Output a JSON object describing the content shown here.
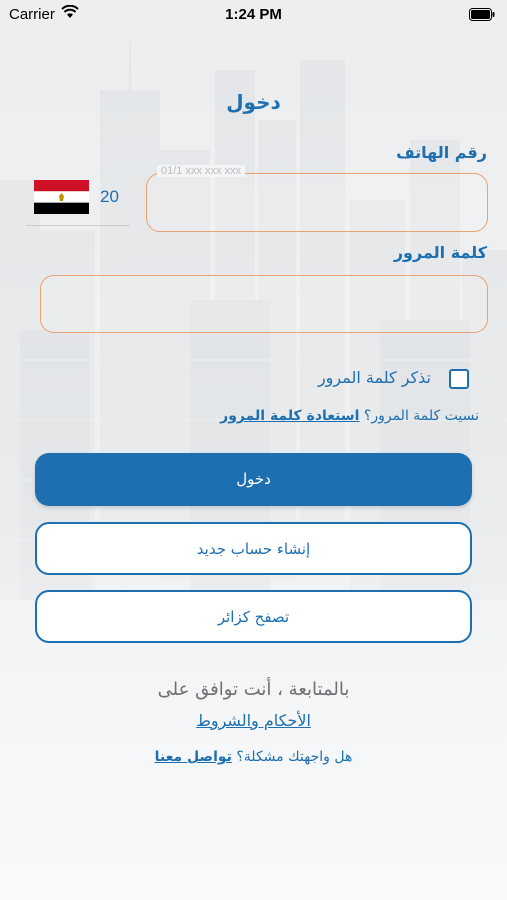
{
  "status_bar": {
    "carrier": "Carrier",
    "time": "1:24 PM"
  },
  "login": {
    "title": "دخول",
    "phone_label": "رقم الهاتف",
    "phone_placeholder": "01/1 xxx xxx xxx",
    "country_code": "20",
    "country_flag": "egypt-flag-icon",
    "password_label": "كلمة المرور",
    "remember_label": "تذكر كلمة المرور",
    "forgot_prefix": "نسيت كلمة المرور؟",
    "forgot_link": "استعادة كلمة المرور",
    "login_button": "دخول",
    "register_button": "إنشاء حساب جديد",
    "guest_button": "تصفح كزائر",
    "agree_text": "بالمتابعة ، أنت توافق على",
    "terms_link": "الأحكام والشروط",
    "contact_prefix": "هل واجهتك مشكلة؟",
    "contact_link": "تواصل معنا"
  },
  "colors": {
    "primary": "#1d6fb0",
    "field_border": "#e9a171",
    "muted_text": "#6c6f73"
  }
}
